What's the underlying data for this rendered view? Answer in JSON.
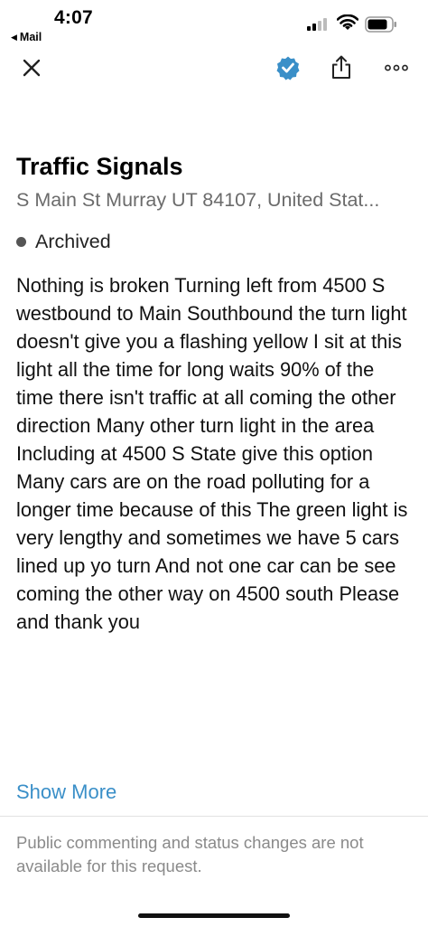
{
  "status_bar": {
    "time": "4:07",
    "back_app": "Mail",
    "signal_icon": "cellular-signal-icon",
    "wifi_icon": "wifi-icon",
    "battery_icon": "battery-icon"
  },
  "toolbar": {
    "close_icon": "close-icon",
    "favorite_icon": "favorite-badge-icon",
    "share_icon": "share-icon",
    "more_icon": "more-icon",
    "accent_color": "#3a8fc8"
  },
  "request": {
    "title": "Traffic Signals",
    "address": "S Main St Murray UT 84107, United Stat...",
    "status": "Archived",
    "description": "Nothing is broken  Turning left from 4500 S westbound to Main Southbound the turn light doesn't give you a flashing yellow  I sit at this light all the time for long waits  90% of the time there isn't traffic at all coming the other direction  Many other turn light in the area  Including at 4500 S State give this option  Many cars are on the road polluting for a longer time because of this  The green light is very lengthy and sometimes we have 5 cars lined up yo turn  And not one car can be see coming the other way on 4500 south Please and thank you",
    "show_more": "Show More"
  },
  "footer": {
    "notice": "Public commenting and status changes are not available for this request."
  }
}
